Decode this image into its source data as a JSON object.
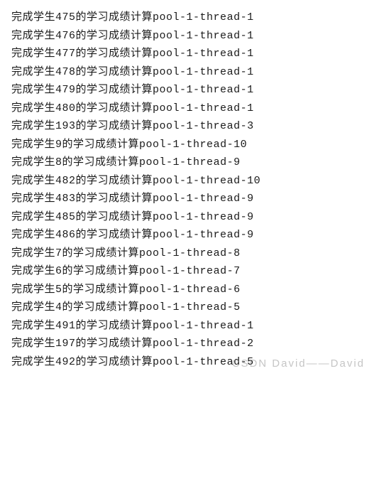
{
  "log": {
    "prefix": "完成学生",
    "middle": "的学习成绩计算",
    "lines": [
      {
        "student": "475",
        "thread": "pool-1-thread-1"
      },
      {
        "student": "476",
        "thread": "pool-1-thread-1"
      },
      {
        "student": "477",
        "thread": "pool-1-thread-1"
      },
      {
        "student": "478",
        "thread": "pool-1-thread-1"
      },
      {
        "student": "479",
        "thread": "pool-1-thread-1"
      },
      {
        "student": "480",
        "thread": "pool-1-thread-1"
      },
      {
        "student": "193",
        "thread": "pool-1-thread-3"
      },
      {
        "student": "9",
        "thread": "pool-1-thread-10"
      },
      {
        "student": "8",
        "thread": "pool-1-thread-9"
      },
      {
        "student": "482",
        "thread": "pool-1-thread-10"
      },
      {
        "student": "483",
        "thread": "pool-1-thread-9"
      },
      {
        "student": "485",
        "thread": "pool-1-thread-9"
      },
      {
        "student": "486",
        "thread": "pool-1-thread-9"
      },
      {
        "student": "7",
        "thread": "pool-1-thread-8"
      },
      {
        "student": "6",
        "thread": "pool-1-thread-7"
      },
      {
        "student": "5",
        "thread": "pool-1-thread-6"
      },
      {
        "student": "4",
        "thread": "pool-1-thread-5"
      },
      {
        "student": "491",
        "thread": "pool-1-thread-1"
      },
      {
        "student": "197",
        "thread": "pool-1-thread-2"
      },
      {
        "student": "492",
        "thread": "pool-1-thread-5"
      }
    ]
  },
  "watermark": "CSDN David——David"
}
